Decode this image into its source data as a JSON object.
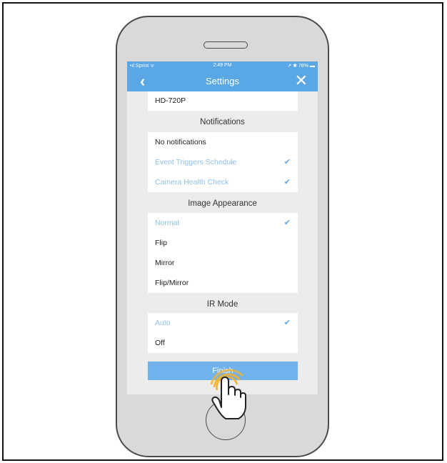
{
  "status_bar": {
    "carrier": "•ıl Sprint ᯤ",
    "time": "2:49 PM",
    "battery": "↗ ✱ 78% ▬"
  },
  "nav": {
    "title": "Settings",
    "back_icon": "chevron-left-icon",
    "close_icon": "close-icon"
  },
  "resolution": {
    "value": "HD-720P"
  },
  "notifications": {
    "header": "Notifications",
    "items": [
      {
        "label": "No notifications",
        "selected": false
      },
      {
        "label": "Event Triggers Schedule",
        "selected": true
      },
      {
        "label": "Camera Health Check",
        "selected": true
      }
    ]
  },
  "image_appearance": {
    "header": "Image Appearance",
    "items": [
      {
        "label": "Normal",
        "selected": true
      },
      {
        "label": "Flip",
        "selected": false
      },
      {
        "label": "Mirror",
        "selected": false
      },
      {
        "label": "Flip/Mirror",
        "selected": false
      }
    ]
  },
  "ir_mode": {
    "header": "IR Mode",
    "items": [
      {
        "label": "Auto",
        "selected": true
      },
      {
        "label": "Off",
        "selected": false
      }
    ]
  },
  "finish": {
    "label": "Finish"
  },
  "colors": {
    "accent": "#5aa7e6",
    "selected_text": "#8fc0ec",
    "phone_body": "#d9d9d9",
    "tap_ripple": "#f2b233"
  }
}
